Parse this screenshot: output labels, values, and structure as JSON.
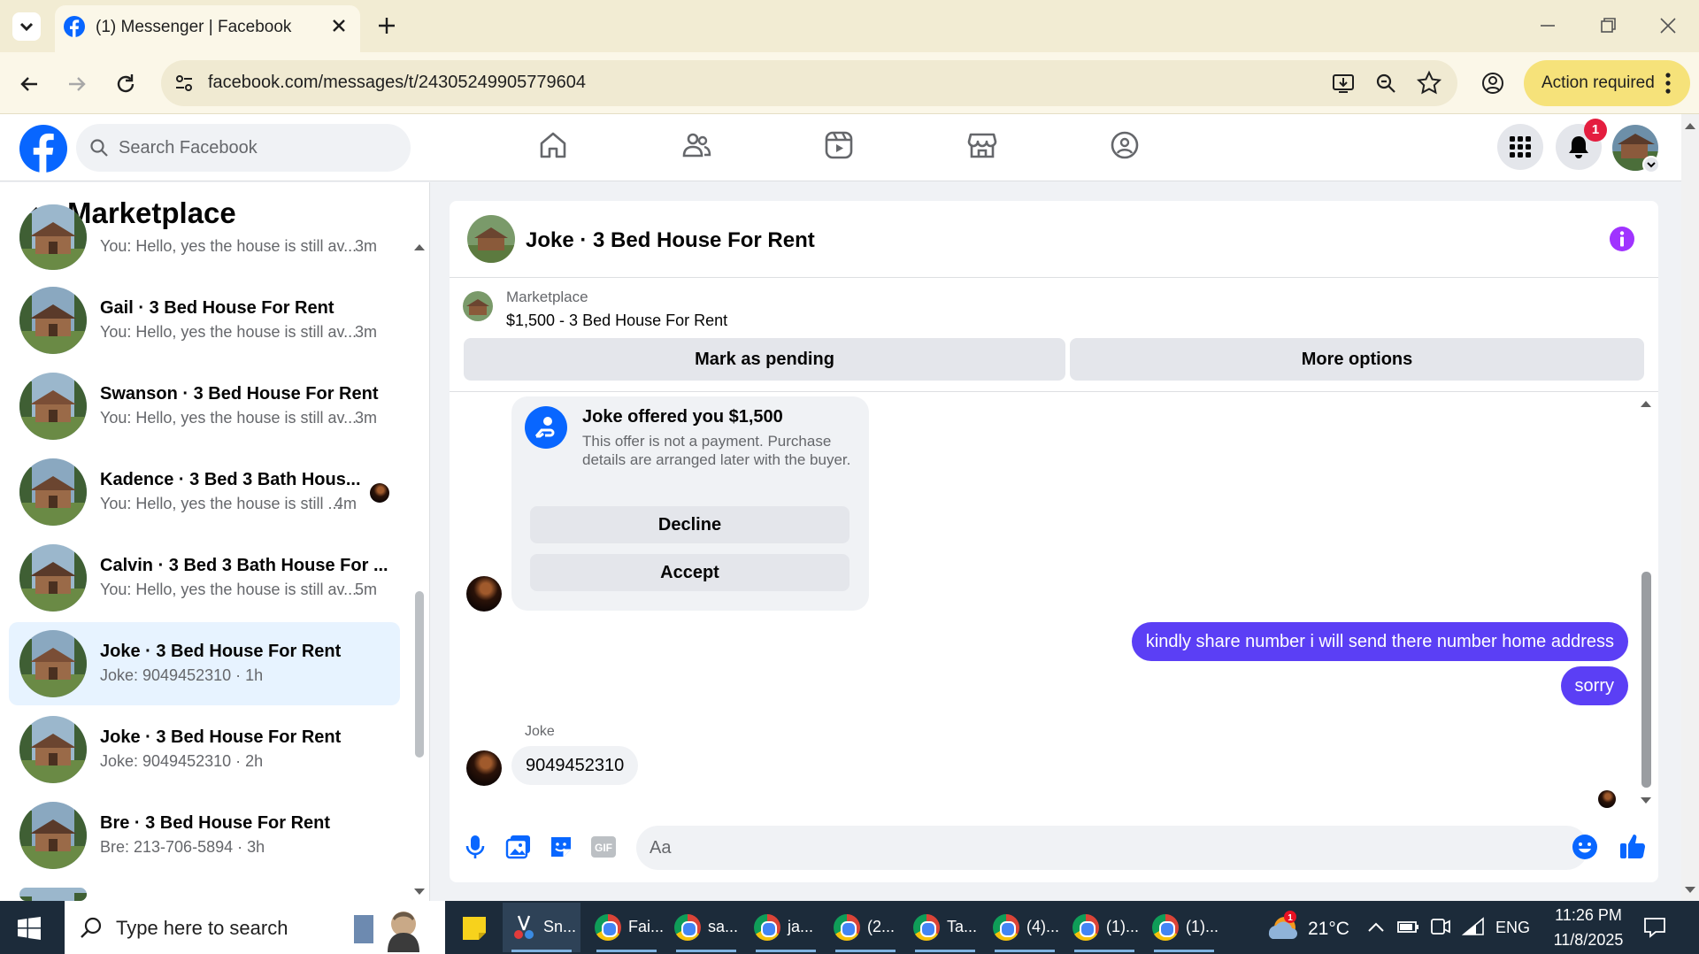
{
  "browser": {
    "tab_title": "(1) Messenger | Facebook",
    "url": "facebook.com/messages/t/24305249905779604",
    "action_required": "Action required"
  },
  "fb": {
    "search_placeholder": "Search Facebook",
    "notifications_count": "1"
  },
  "sidebar": {
    "title": "Marketplace",
    "conversations": [
      {
        "name": "",
        "snippet": "You: Hello, yes the house is still av...",
        "time": "3m"
      },
      {
        "name": "Gail · 3 Bed House For Rent",
        "snippet": "You: Hello, yes the house is still av...",
        "time": "3m"
      },
      {
        "name": "Swanson · 3 Bed House For Rent",
        "snippet": "You: Hello, yes the house is still av...",
        "time": "3m"
      },
      {
        "name": "Kadence · 3 Bed 3 Bath Hous...",
        "snippet": "You: Hello, yes the house is still ...",
        "time": "4m"
      },
      {
        "name": "Calvin · 3 Bed 3 Bath House For ...",
        "snippet": "You: Hello, yes the house is still av...",
        "time": "5m"
      },
      {
        "name": "Joke · 3 Bed House For Rent",
        "snippet": "Joke: 9049452310 · 1h",
        "time": ""
      },
      {
        "name": "Joke · 3 Bed House For Rent",
        "snippet": "Joke: 9049452310 · 2h",
        "time": ""
      },
      {
        "name": "Bre · 3 Bed House For Rent",
        "snippet": "Bre: 213-706-5894 · 3h",
        "time": ""
      }
    ]
  },
  "chat": {
    "header_name": "Joke · 3 Bed House For Rent",
    "listing_category": "Marketplace",
    "listing_title": "$1,500 - 3 Bed House For Rent",
    "mark_pending": "Mark as pending",
    "more_options": "More options",
    "offer": {
      "title": "Joke offered you $1,500",
      "description": "This offer is not a payment. Purchase details are arranged later with the buyer.",
      "decline": "Decline",
      "accept": "Accept"
    },
    "messages_out": [
      "kindly share number i will send there number home address",
      "sorry"
    ],
    "sender_label": "Joke",
    "message_in": "9049452310",
    "composer_placeholder": "Aa"
  },
  "taskbar": {
    "search_placeholder": "Type here to search",
    "apps": [
      "Sn...",
      "Fai...",
      "sa...",
      "ja...",
      "(2...",
      "Ta...",
      "(4)...",
      "(1)...",
      "(1)..."
    ],
    "temperature": "21°C",
    "language": "ENG",
    "time": "11:26 PM",
    "date": "11/8/2025"
  },
  "colors": {
    "fb_blue": "#0866ff",
    "outgoing_bubble": "#5b3ff5",
    "info_purple": "#a033ff",
    "action_required_bg": "#f6e27a"
  }
}
